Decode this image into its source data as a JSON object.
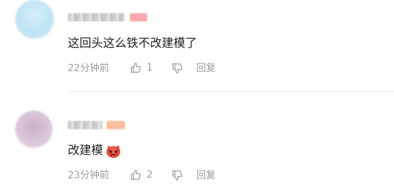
{
  "comments": [
    {
      "text": "这回头这么铁不改建模了",
      "time": "22分钟前",
      "likes": "1",
      "reply_label": "回复",
      "avatar_color": "#bfe4f5",
      "badge_color": "#f7a9ad"
    },
    {
      "text": "改建模",
      "emoji": "angry-face-emoji",
      "time": "23分钟前",
      "likes": "2",
      "reply_label": "回复",
      "avatar_color": "#d7c2d6",
      "badge_color": "#fbbf9d"
    }
  ],
  "colors": {
    "meta_text": "#9a9a9a",
    "body_text": "#222222",
    "divider": "#ececec"
  }
}
